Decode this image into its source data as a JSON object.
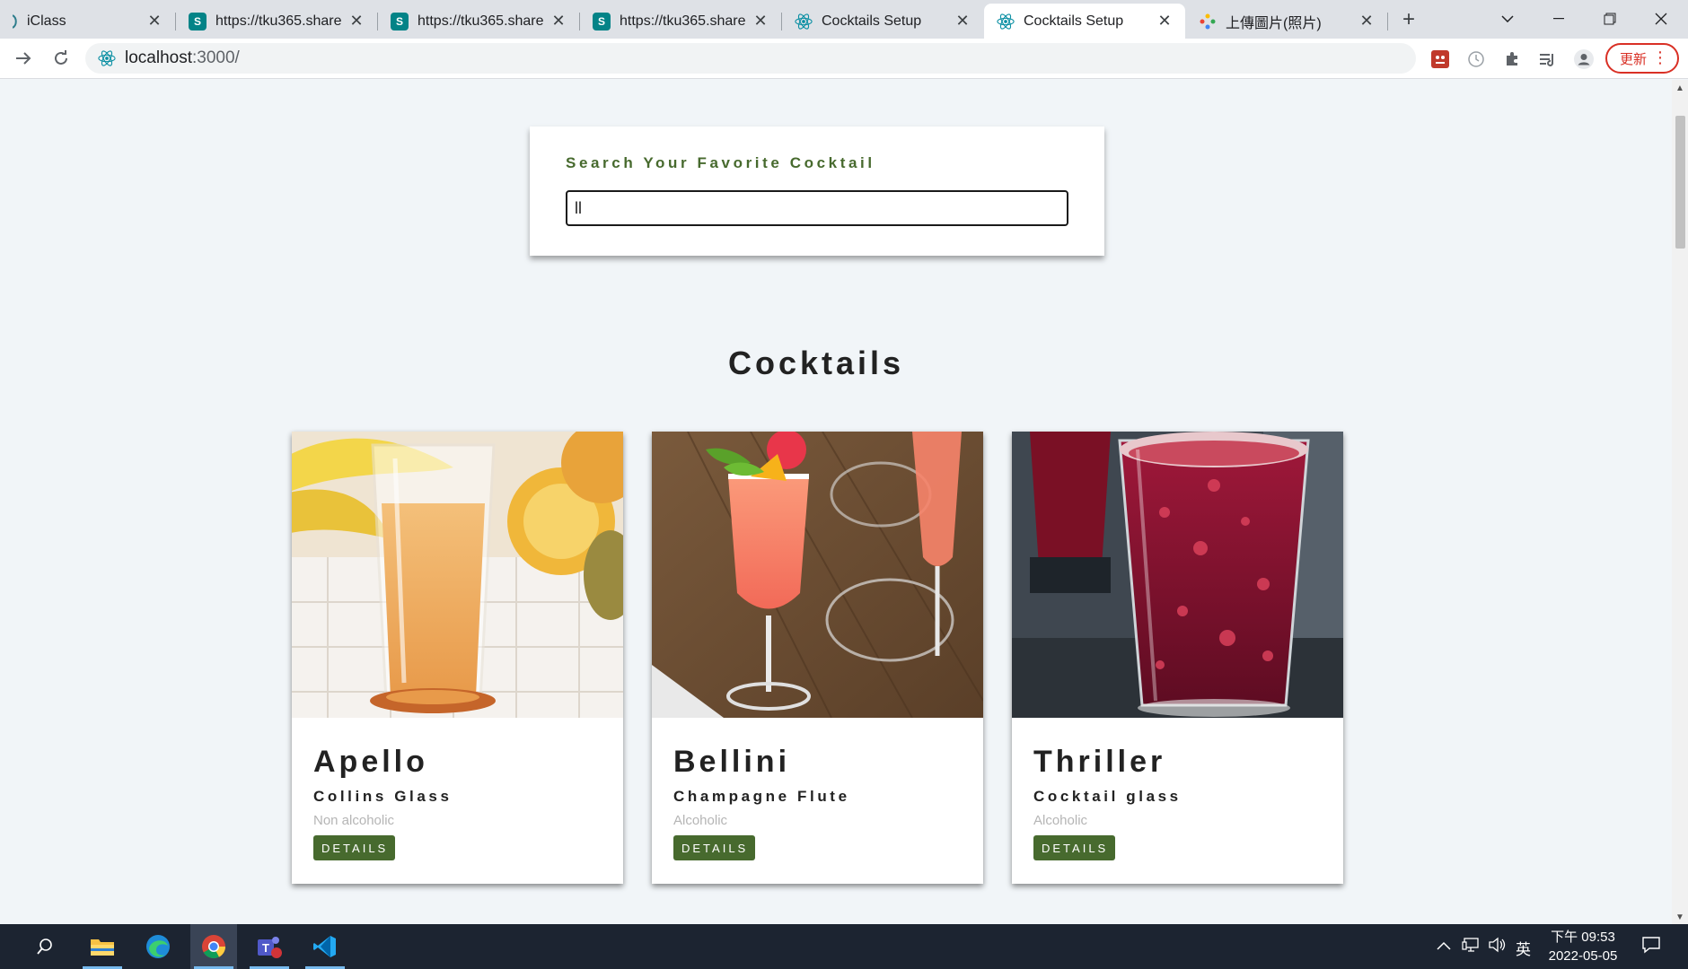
{
  "browser": {
    "tabs": [
      {
        "title": "iClass",
        "favicon": "iclass-icon"
      },
      {
        "title": "https://tku365.share",
        "favicon": "sharepoint-icon"
      },
      {
        "title": "https://tku365.share",
        "favicon": "sharepoint-icon"
      },
      {
        "title": "https://tku365.share",
        "favicon": "sharepoint-icon"
      },
      {
        "title": "Cocktails Setup",
        "favicon": "react-icon"
      },
      {
        "title": "Cocktails Setup",
        "favicon": "react-icon",
        "active": true
      },
      {
        "title": "上傳圖片(照片)",
        "favicon": "photos-icon"
      }
    ],
    "sharepoint_letter": "S",
    "url_host": "localhost",
    "url_path": ":3000/",
    "update_label": "更新",
    "colors": {
      "accent": "#d93025"
    }
  },
  "page": {
    "search": {
      "label": "Search Your Favorite Cocktail",
      "value": "ll"
    },
    "section_title": "Cocktails",
    "details_label": "DETAILS",
    "cocktails": [
      {
        "name": "Apello",
        "glass": "Collins Glass",
        "info": "Non alcoholic",
        "image": "orange-juice-photo"
      },
      {
        "name": "Bellini",
        "glass": "Champagne Flute",
        "info": "Alcoholic",
        "image": "peach-flute-photo"
      },
      {
        "name": "Thriller",
        "glass": "Cocktail glass",
        "info": "Alcoholic",
        "image": "red-soda-photo"
      }
    ],
    "colors": {
      "primary": "#476a2e",
      "background": "#f1f5f8"
    }
  },
  "taskbar": {
    "time": "下午 09:53",
    "date": "2022-05-05",
    "ime": "英",
    "apps": [
      "search-icon",
      "file-explorer-icon",
      "edge-icon",
      "chrome-icon",
      "teams-icon",
      "vscode-icon"
    ]
  }
}
